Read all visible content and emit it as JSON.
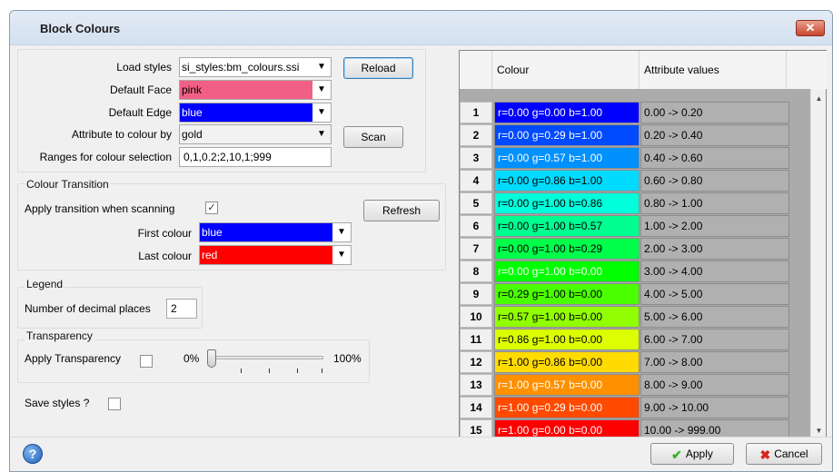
{
  "window": {
    "title": "Block Colours",
    "close_label": "✕"
  },
  "styles": {
    "load_label": "Load styles",
    "load_value": "si_styles:bm_colours.ssi",
    "reload_label": "Reload",
    "face_label": "Default Face",
    "face_value": "pink",
    "face_color": "#f25f86",
    "edge_label": "Default Edge",
    "edge_value": "blue",
    "edge_color": "#0000ff",
    "attr_label": "Attribute to colour by",
    "attr_value": "gold",
    "scan_label": "Scan",
    "ranges_label": "Ranges for colour selection",
    "ranges_value": "0,1,0.2;2,10,1;999"
  },
  "transition": {
    "title": "Colour Transition",
    "apply_label": "Apply transition when scanning",
    "apply_checked": "✓",
    "refresh_label": "Refresh",
    "first_label": "First colour",
    "first_value": "blue",
    "first_color": "#0000ff",
    "last_label": "Last colour",
    "last_value": "red",
    "last_color": "#ff0000"
  },
  "legend": {
    "title": "Legend",
    "decimals_label": "Number of decimal places",
    "decimals_value": "2"
  },
  "transparency": {
    "title": "Transparency",
    "apply_label": "Apply Transparency",
    "min_label": "0%",
    "max_label": "100%",
    "value": 0
  },
  "save": {
    "label": "Save styles ?"
  },
  "grid": {
    "col_colour": "Colour",
    "col_attr": "Attribute values",
    "rows": [
      {
        "num": "1",
        "colour": "r=0.00 g=0.00 b=1.00",
        "attr": "0.00 -> 0.20",
        "bg": "#0000ff",
        "fg": "#ffffff"
      },
      {
        "num": "2",
        "colour": "r=0.00 g=0.29 b=1.00",
        "attr": "0.20 -> 0.40",
        "bg": "#004aff",
        "fg": "#ffffff"
      },
      {
        "num": "3",
        "colour": "r=0.00 g=0.57 b=1.00",
        "attr": "0.40 -> 0.60",
        "bg": "#0091ff",
        "fg": "#ffffff"
      },
      {
        "num": "4",
        "colour": "r=0.00 g=0.86 b=1.00",
        "attr": "0.60 -> 0.80",
        "bg": "#00dbff",
        "fg": "#000000"
      },
      {
        "num": "5",
        "colour": "r=0.00 g=1.00 b=0.86",
        "attr": "0.80 -> 1.00",
        "bg": "#00ffdb",
        "fg": "#000000"
      },
      {
        "num": "6",
        "colour": "r=0.00 g=1.00 b=0.57",
        "attr": "1.00 -> 2.00",
        "bg": "#00ff91",
        "fg": "#000000"
      },
      {
        "num": "7",
        "colour": "r=0.00 g=1.00 b=0.29",
        "attr": "2.00 -> 3.00",
        "bg": "#00ff4a",
        "fg": "#000000"
      },
      {
        "num": "8",
        "colour": "r=0.00 g=1.00 b=0.00",
        "attr": "3.00 -> 4.00",
        "bg": "#00ff00",
        "fg": "#ffffff"
      },
      {
        "num": "9",
        "colour": "r=0.29 g=1.00 b=0.00",
        "attr": "4.00 -> 5.00",
        "bg": "#4aff00",
        "fg": "#000000"
      },
      {
        "num": "10",
        "colour": "r=0.57 g=1.00 b=0.00",
        "attr": "5.00 -> 6.00",
        "bg": "#91ff00",
        "fg": "#000000"
      },
      {
        "num": "11",
        "colour": "r=0.86 g=1.00 b=0.00",
        "attr": "6.00 -> 7.00",
        "bg": "#dbff00",
        "fg": "#000000"
      },
      {
        "num": "12",
        "colour": "r=1.00 g=0.86 b=0.00",
        "attr": "7.00 -> 8.00",
        "bg": "#ffdb00",
        "fg": "#000000"
      },
      {
        "num": "13",
        "colour": "r=1.00 g=0.57 b=0.00",
        "attr": "8.00 -> 9.00",
        "bg": "#ff9100",
        "fg": "#ffffff"
      },
      {
        "num": "14",
        "colour": "r=1.00 g=0.29 b=0.00",
        "attr": "9.00 -> 10.00",
        "bg": "#ff4a00",
        "fg": "#ffffff"
      },
      {
        "num": "15",
        "colour": "r=1.00 g=0.00 b=0.00",
        "attr": "10.00 -> 999.00",
        "bg": "#ff0000",
        "fg": "#ffffff"
      }
    ]
  },
  "buttons": {
    "help_label": "?",
    "apply_label": "Apply",
    "apply_icon": "✔",
    "cancel_label": "Cancel",
    "cancel_icon": "✖"
  }
}
